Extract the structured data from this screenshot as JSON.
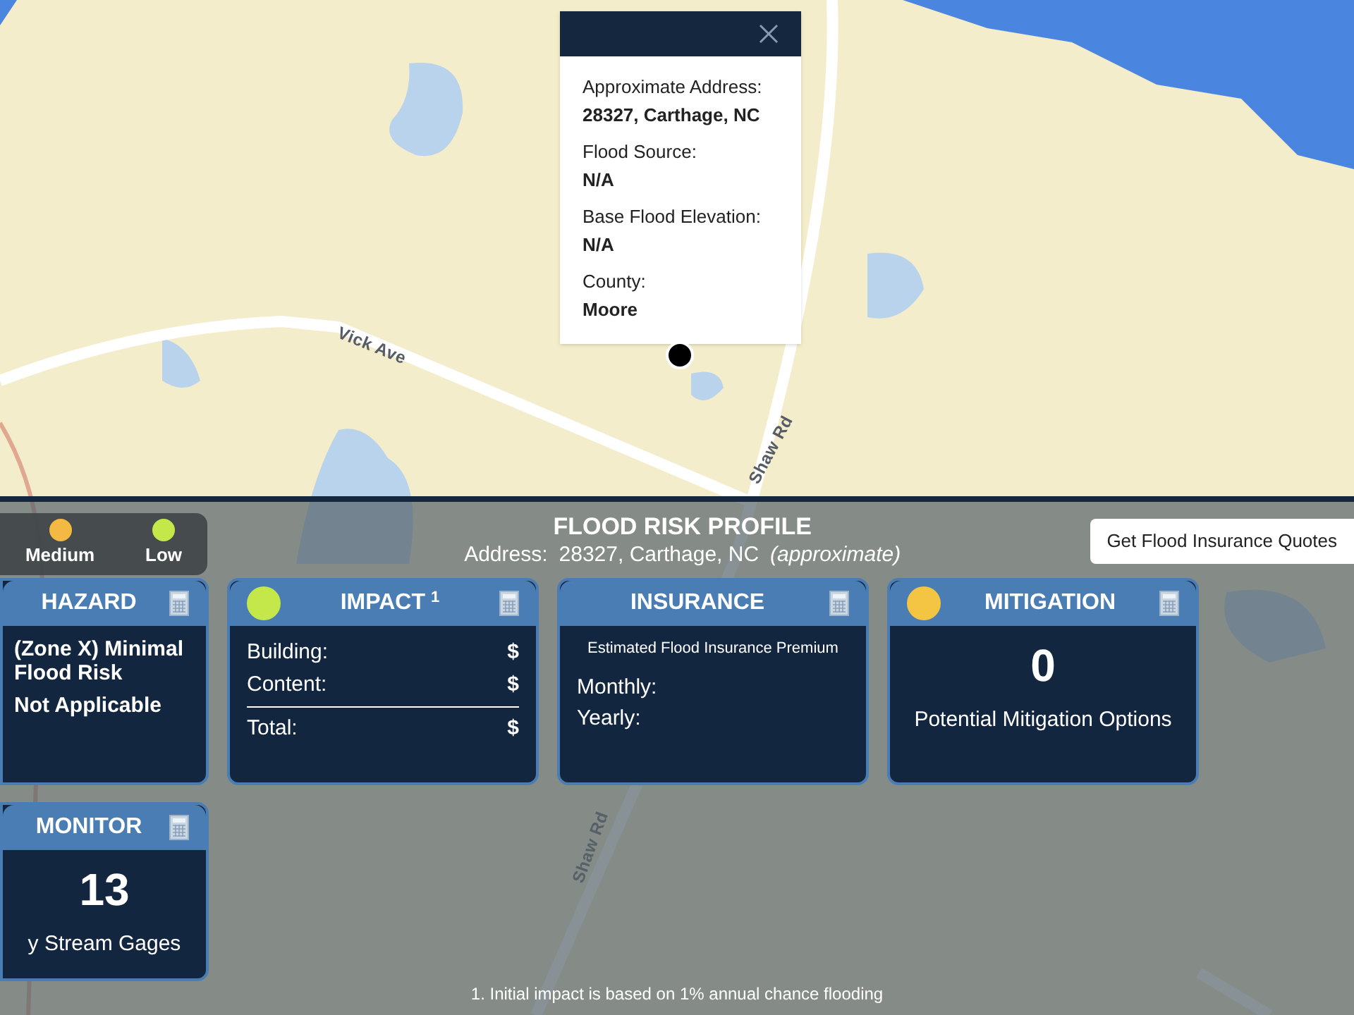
{
  "map": {
    "labels": [
      {
        "text": "Vick Ave",
        "kind": "vick"
      },
      {
        "text": "Shaw Rd",
        "kind": "shaw_top"
      },
      {
        "text": "Shaw Rd",
        "kind": "shaw_bottom"
      }
    ]
  },
  "popup": {
    "fields": [
      {
        "label": "Approximate Address:",
        "value": "28327, Carthage, NC"
      },
      {
        "label": "Flood Source:",
        "value": "N/A"
      },
      {
        "label": "Base Flood Elevation:",
        "value": "N/A"
      },
      {
        "label": "County:",
        "value": "Moore"
      }
    ]
  },
  "panel": {
    "title": "FLOOD RISK PROFILE",
    "address_label": "Address:",
    "address": "28327, Carthage, NC",
    "address_note": "(approximate)",
    "quote_button": "Get Flood Insurance Quotes",
    "legend": [
      {
        "label": "Medium",
        "color": "#f4b942"
      },
      {
        "label": "Low",
        "color": "#c4e84a"
      }
    ],
    "cards": [
      {
        "kind": "hazard",
        "title": "HAZARD",
        "lines": [
          "(Zone X) Minimal Flood Risk",
          "Not Applicable"
        ]
      },
      {
        "kind": "impact",
        "title": "IMPACT",
        "footnote_mark": "1",
        "color": "#c4e84a",
        "rows": [
          {
            "label": "Building:",
            "value": "$"
          },
          {
            "label": "Content:",
            "value": "$"
          },
          {
            "label": "Total:",
            "value": "$"
          }
        ]
      },
      {
        "kind": "insurance",
        "title": "INSURANCE",
        "subtitle": "Estimated Flood Insurance Premium",
        "rows": [
          {
            "label": "Monthly:"
          },
          {
            "label": "Yearly:"
          }
        ]
      },
      {
        "kind": "mitigation",
        "title": "MITIGATION",
        "color": "#f4c542",
        "number": "0",
        "caption": "Potential Mitigation Options"
      },
      {
        "kind": "monitor",
        "title": "MONITOR",
        "number": "13",
        "caption": "y Stream Gages"
      }
    ],
    "footnote": "1. Initial impact is based on 1% annual chance flooding"
  }
}
